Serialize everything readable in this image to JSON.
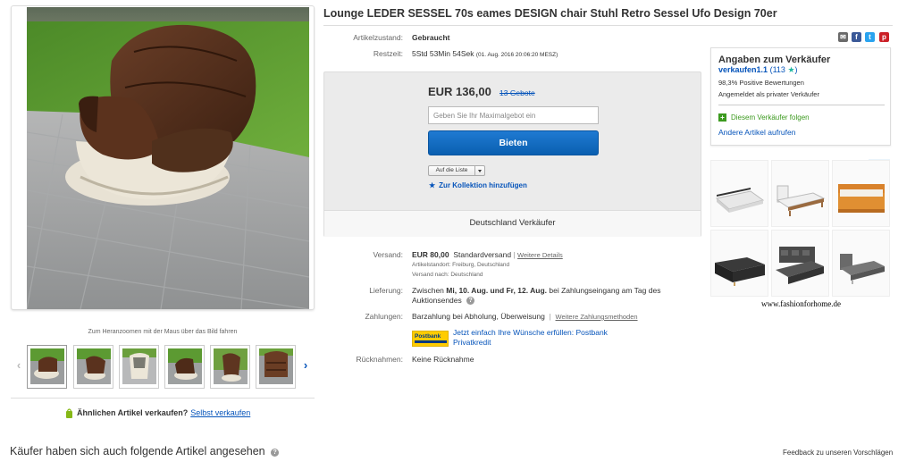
{
  "item": {
    "title": "Lounge LEDER SESSEL 70s eames DESIGN chair Stuhl Retro Sessel Ufo Design 70er",
    "zoom_hint": "Zum Heranzoomen mit der Maus über das Bild fahren",
    "similar_question": "Ähnlichen Artikel verkaufen?",
    "similar_link": "Selbst verkaufen"
  },
  "info": {
    "condition_label": "Artikelzustand:",
    "condition_value": "Gebraucht",
    "time_label": "Restzeit:",
    "time_value": "5Std 53Min 54Sek",
    "time_end": "(01. Aug. 2016  20:06:20 MESZ)"
  },
  "bid": {
    "price": "EUR 136,00",
    "bids_count": "13 Gebote",
    "max_bid_placeholder": "Geben Sie Ihr Maximalgebot ein",
    "bid_button": "Bieten",
    "watch_button": "Auf die Liste",
    "collection_link": "Zur Kollektion hinzufügen",
    "seller_location": "Deutschland Verkäufer"
  },
  "shipping": {
    "label": "Versand:",
    "cost": "EUR 80,00",
    "method": "Standardversand",
    "sep": "|",
    "more_link": "Weitere Details",
    "location": "Artikelstandort: Freiburg, Deutschland",
    "ships_to": "Versand nach: Deutschland"
  },
  "delivery": {
    "label": "Lieferung:",
    "prefix": "Zwischen",
    "dates": "Mi, 10. Aug. und Fr, 12. Aug.",
    "suffix": "bei Zahlungseingang am Tag des",
    "line2": "Auktionsendes"
  },
  "payment": {
    "label": "Zahlungen:",
    "methods": "Barzahlung bei Abholung,  Überweisung",
    "sep": "|",
    "more_link": "Weitere Zahlungsmethoden",
    "postbank_logo": "Postbank",
    "postbank_line1": "Jetzt einfach Ihre Wünsche erfüllen: Postbank",
    "postbank_line2": "Privatkredit"
  },
  "returns": {
    "label": "Rücknahmen:",
    "value": "Keine Rücknahme"
  },
  "seller": {
    "heading": "Angaben zum Verkäufer",
    "name": "verkaufen1.1",
    "score": "113",
    "positive": "98,3% Positive Bewertungen",
    "type": "Angemeldet als privater Verkäufer",
    "follow": "Diesem Verkäufer folgen",
    "other_items": "Andere Artikel aufrufen"
  },
  "ad": {
    "url": "www.fashionforhome.de"
  },
  "footer": {
    "also_viewed": "Käufer haben sich auch folgende Artikel angesehen",
    "feedback": "Feedback zu unseren Vorschlägen"
  },
  "colors": {
    "link": "#0654ba",
    "bid_button": "#0a5fb0",
    "green": "#3c9a1f",
    "postbank": "#ffcc00"
  },
  "icons": [
    "email-icon",
    "facebook-icon",
    "twitter-icon",
    "pinterest-icon",
    "star-icon",
    "help-icon",
    "bag-icon",
    "plus-icon",
    "chevron-left-icon",
    "chevron-right-icon"
  ]
}
